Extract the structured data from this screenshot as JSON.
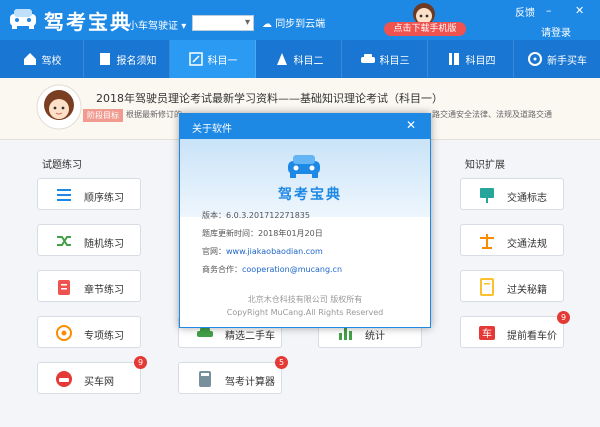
{
  "app": {
    "title": "驾考宝典"
  },
  "titlebar": {
    "license_type": "小车驾驶证",
    "sync_label": "同步到云端",
    "download_label": "点击下载手机版",
    "feedback": "反馈",
    "login": "请登录",
    "minimize_glyph": "–",
    "close_glyph": "✕"
  },
  "nav": [
    {
      "label": "驾校"
    },
    {
      "label": "报名须知"
    },
    {
      "label": "科目一"
    },
    {
      "label": "科目二"
    },
    {
      "label": "科目三"
    },
    {
      "label": "科目四"
    },
    {
      "label": "新手买车"
    }
  ],
  "banner": {
    "title": "2018年驾驶员理论考试最新学习资料——基础知识理论考试（科目一）",
    "tag": "阶段目标",
    "desc": "根据最新修订的",
    "desc_end": "路交通安全法律、法规及道路交通"
  },
  "sections": {
    "practice": "试题练习",
    "knowledge": "知识扩展"
  },
  "practice_tiles": [
    {
      "label": "顺序练习"
    },
    {
      "label": "随机练习"
    },
    {
      "label": "章节练习"
    },
    {
      "label": "专项练习"
    },
    {
      "label": "买车网",
      "badge": "9"
    }
  ],
  "middle_tiles": [
    {
      "label": "精选二手车"
    },
    {
      "label": "驾考计算器",
      "badge": "5"
    }
  ],
  "stats_tile": {
    "label": "统计"
  },
  "knowledge_tiles": [
    {
      "label": "交通标志"
    },
    {
      "label": "交通法规"
    },
    {
      "label": "过关秘籍"
    },
    {
      "label": "提前看车价",
      "badge": "9"
    }
  ],
  "dialog": {
    "title": "关于软件",
    "app_name": "驾考宝典",
    "version_label": "版本：",
    "version": "6.0.3.201712271835",
    "update_label": "题库更新时间：",
    "update": "2018年01月20日",
    "site_label": "官网：",
    "site": "www.jiakaobaodian.com",
    "contact_label": "商务合作：",
    "contact": "cooperation@mucang.cn",
    "company": "北京木仓科技有限公司 版权所有",
    "copyright": "CopyRight MuCang.All Rights Reserved"
  },
  "colors": {
    "brand": "#1e88e5",
    "nav": "#1976d2",
    "accent": "#ef5350"
  }
}
